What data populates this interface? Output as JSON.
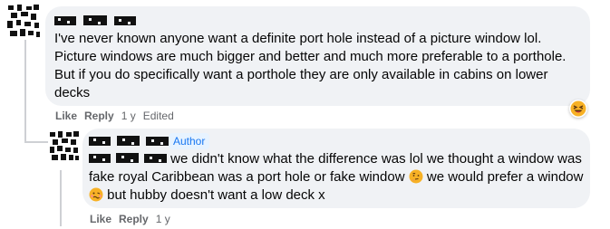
{
  "comments": [
    {
      "author_name": "███ ███ ███",
      "text": "I've never known anyone want a definite port hole instead of a picture window lol. Picture windows are much bigger and better and much more preferable to a porthole. But if you do specifically want a porthole they are only available in cabins on lower decks",
      "like_label": "Like",
      "reply_label": "Reply",
      "age": "1 y",
      "edited_label": "Edited",
      "reaction_icon": "laughing-emoji-icon"
    },
    {
      "author_name": "███ ███ ███",
      "author_badge": "Author",
      "mention": "███ ███ ███",
      "text_part1": " we didn't know what the difference was lol we thought a window was fake royal Caribbean was a port hole or fake window",
      "text_part2": " we would prefer a window",
      "text_part3": " but hubby doesn't want a low deck x",
      "like_label": "Like",
      "reply_label": "Reply",
      "age": "1 y"
    }
  ],
  "colors": {
    "bubble_bg": "#f0f2f5",
    "meta_gray": "#65676b",
    "author_blue": "#1877f2"
  }
}
